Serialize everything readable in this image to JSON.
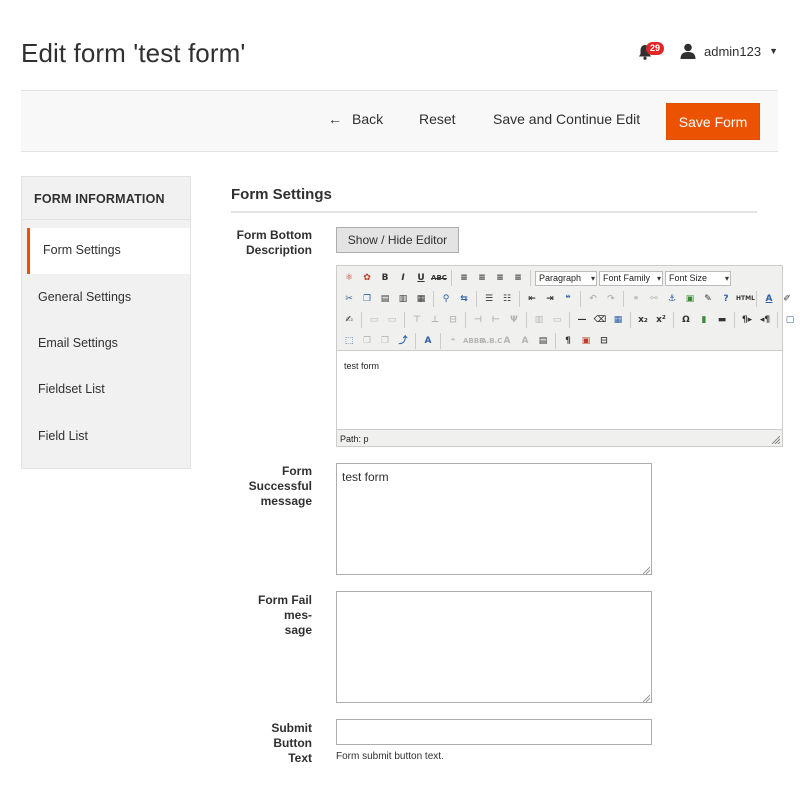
{
  "page": {
    "title": "Edit form 'test form'"
  },
  "header": {
    "notifications_count": "29",
    "username": "admin123",
    "icons": {
      "notifications": "bell-icon",
      "user": "user-icon",
      "menu": "chevron-down-icon"
    }
  },
  "actions": {
    "back": "Back",
    "reset": "Reset",
    "save_continue": "Save and Continue Edit",
    "save": "Save Form"
  },
  "sidebar": {
    "title": "FORM INFORMATION",
    "items": [
      {
        "label": "Form Settings",
        "active": true
      },
      {
        "label": "General Settings"
      },
      {
        "label": "Email Settings"
      },
      {
        "label": "Fieldset List"
      },
      {
        "label": "Field List"
      }
    ]
  },
  "form_settings": {
    "title": "Form Settings",
    "bottom_description": {
      "label_line1": "Form Bottom",
      "label_line2": "Description",
      "toggle_button": "Show / Hide Editor",
      "editor": {
        "format_select": "Paragraph",
        "font_family_select": "Font Family",
        "font_size_select": "Font Size",
        "content": "test form",
        "path": "Path: p"
      }
    },
    "success_message": {
      "label_line1": "Form",
      "label_line2": "Successful",
      "label_line3": "message",
      "value": "test form"
    },
    "fail_message": {
      "label_line1": "Form Fail mes-",
      "label_line2": "sage",
      "value": ""
    },
    "submit_text": {
      "label_line1": "Submit Button",
      "label_line2": "Text",
      "value": "",
      "note": "Form submit button text."
    }
  },
  "colors": {
    "accent": "#eb5202",
    "badge": "#e22626",
    "text": "#303030",
    "panel": "#f1f1f1"
  }
}
